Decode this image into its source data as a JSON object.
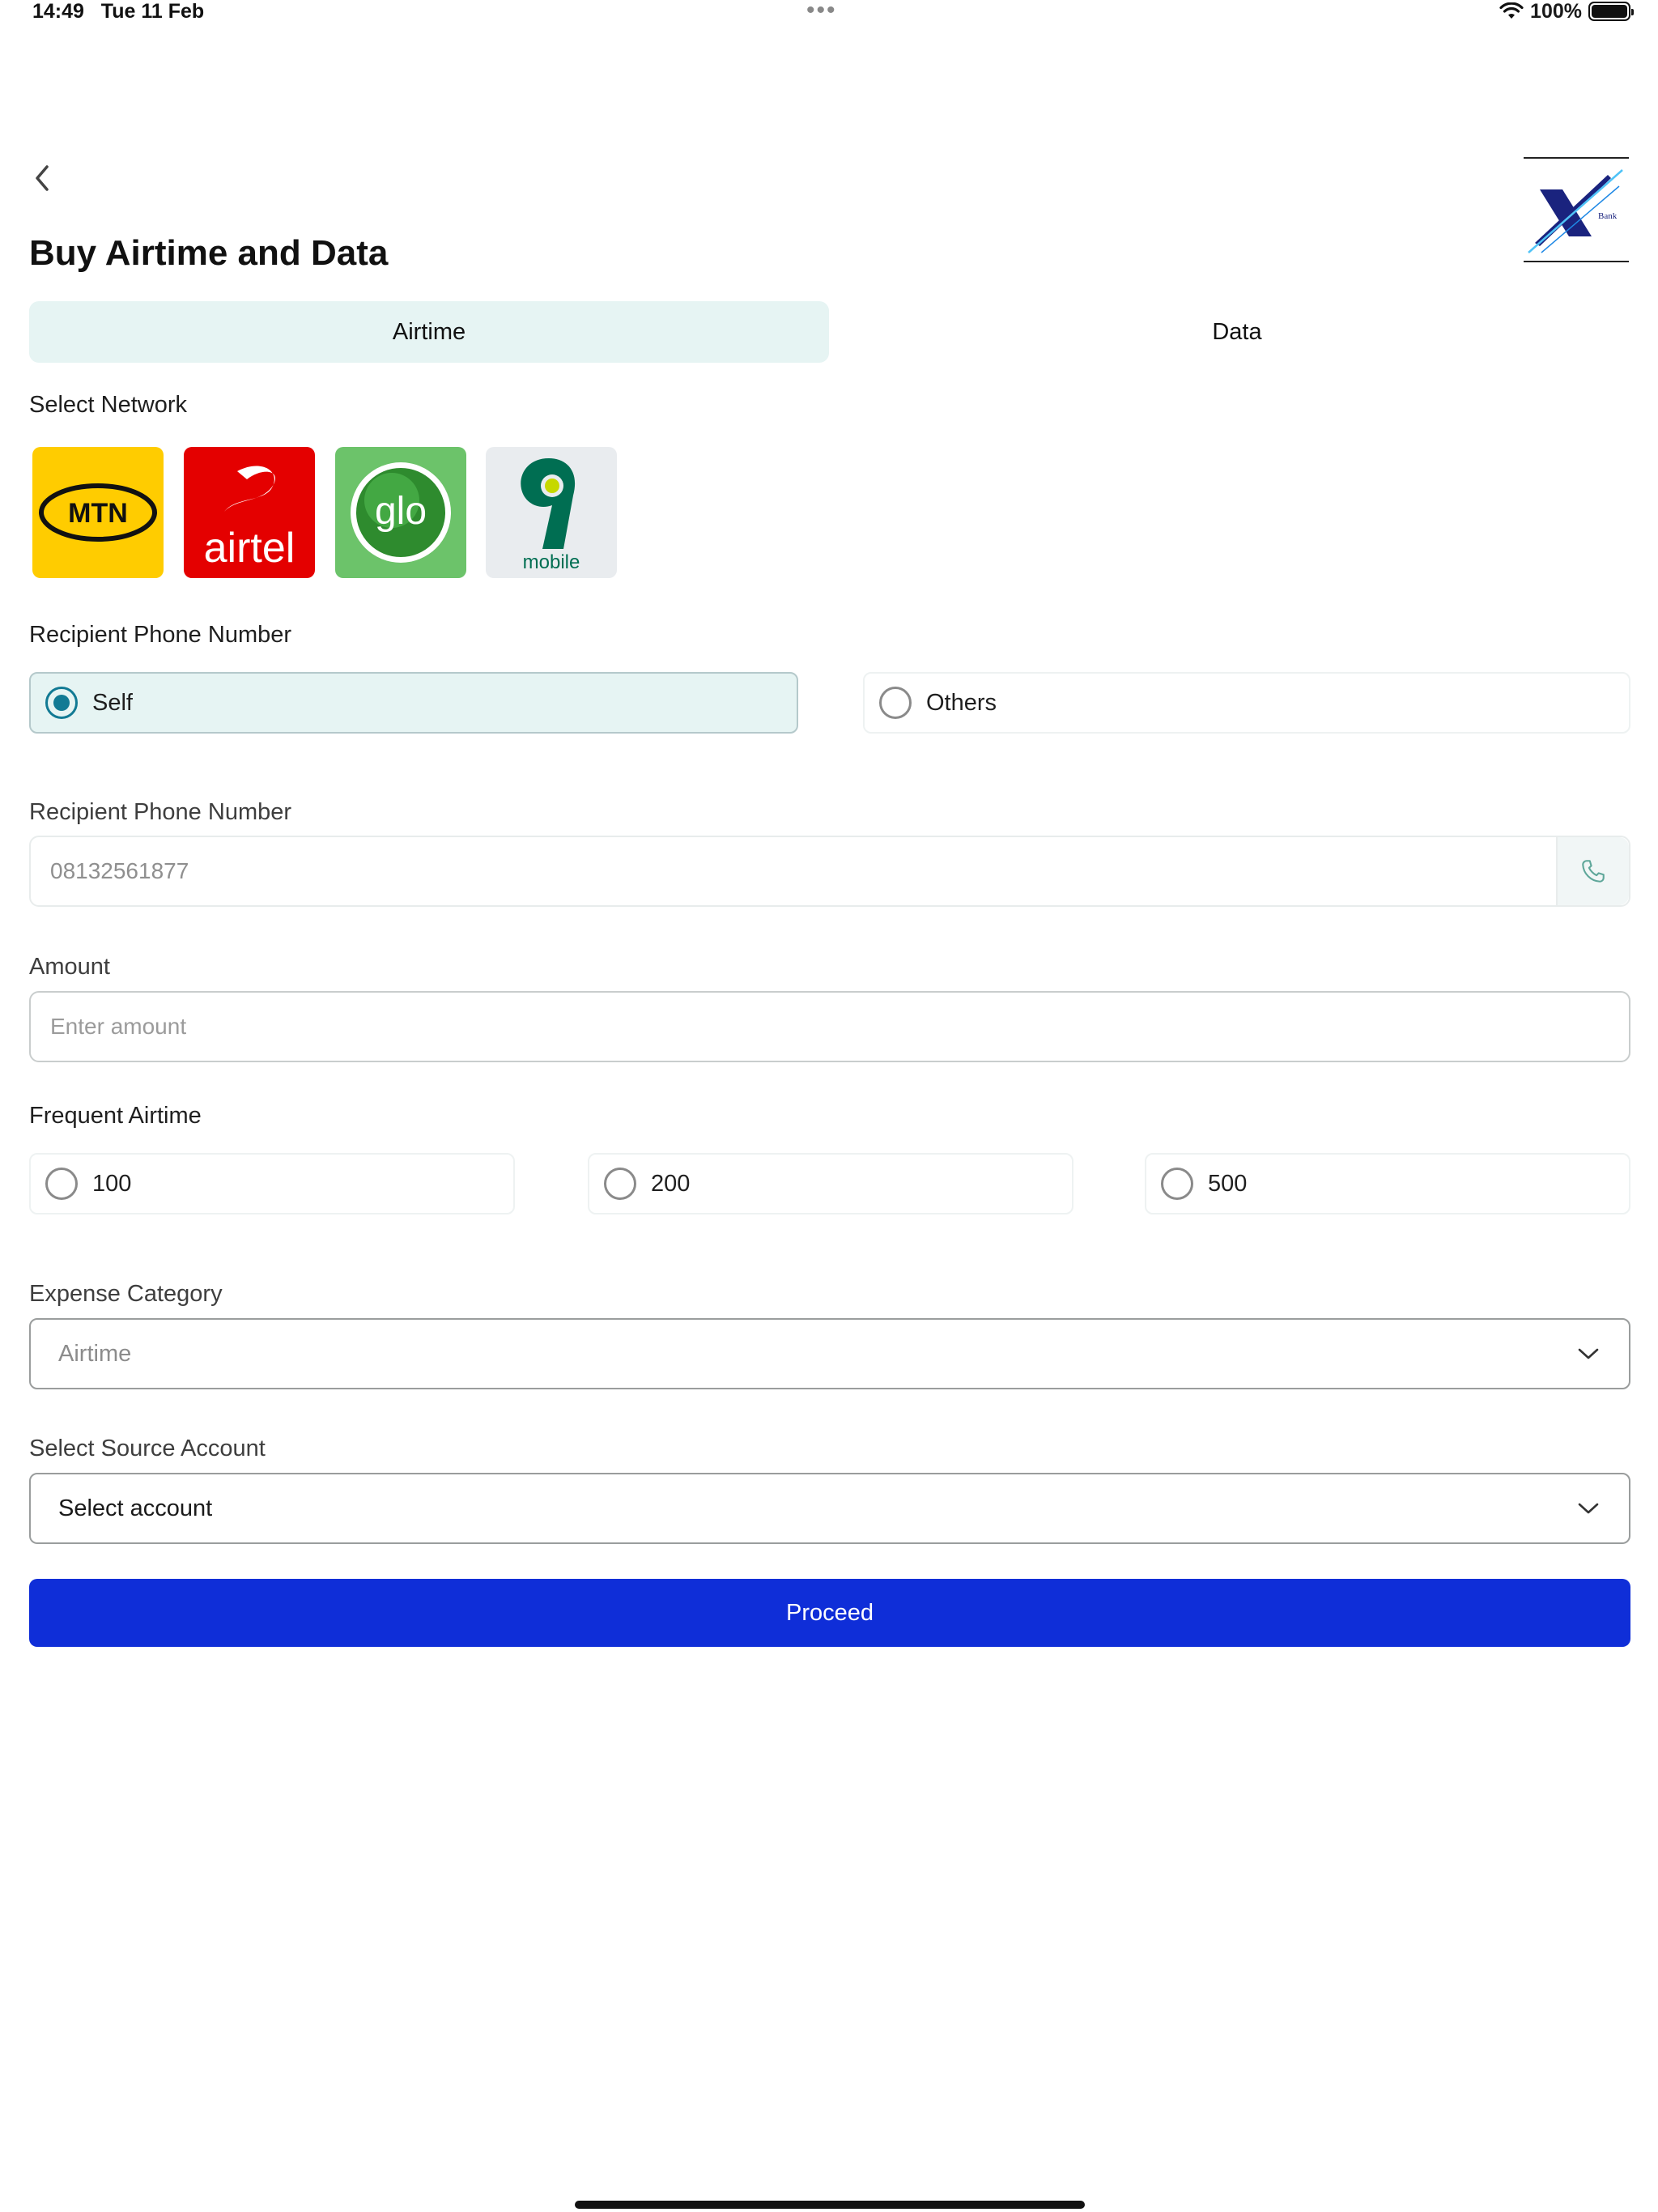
{
  "status_bar": {
    "time": "14:49",
    "date": "Tue 11 Feb",
    "battery": "100%",
    "wifi_icon": "wifi-icon",
    "battery_icon": "battery-icon"
  },
  "header": {
    "back_icon": "chevron-left-icon",
    "title": "Buy Airtime and Data",
    "logo_text": "Bank"
  },
  "tabs": [
    {
      "label": "Airtime",
      "active": true
    },
    {
      "label": "Data",
      "active": false
    }
  ],
  "network": {
    "label": "Select Network",
    "providers": [
      {
        "name": "mtn",
        "logo_text": "MTN",
        "color": "#ffcc00"
      },
      {
        "name": "airtel",
        "logo_text": "airtel",
        "color": "#e40000"
      },
      {
        "name": "glo",
        "logo_text": "glo",
        "color": "#6cc36a"
      },
      {
        "name": "9mobile",
        "logo_text": "mobile",
        "color": "#006e52"
      }
    ]
  },
  "recipient_choice": {
    "label": "Recipient Phone Number",
    "options": [
      {
        "label": "Self",
        "selected": true
      },
      {
        "label": "Others",
        "selected": false
      }
    ]
  },
  "recipient_phone": {
    "label": "Recipient Phone Number",
    "value": "08132561877",
    "icon": "phone-icon"
  },
  "amount": {
    "label": "Amount",
    "placeholder": "Enter amount"
  },
  "frequent_airtime": {
    "label": "Frequent Airtime",
    "options": [
      {
        "label": "100",
        "selected": false
      },
      {
        "label": "200",
        "selected": false
      },
      {
        "label": "500",
        "selected": false
      }
    ]
  },
  "expense_category": {
    "label": "Expense Category",
    "value": "Airtime",
    "icon": "chevron-down-icon"
  },
  "source_account": {
    "label": "Select Source Account",
    "value": "Select account",
    "icon": "chevron-down-icon"
  },
  "proceed_button": {
    "label": "Proceed",
    "color": "#0f2ed8"
  },
  "accent_color": "#127a94",
  "tab_active_bg": "#e6f4f3"
}
